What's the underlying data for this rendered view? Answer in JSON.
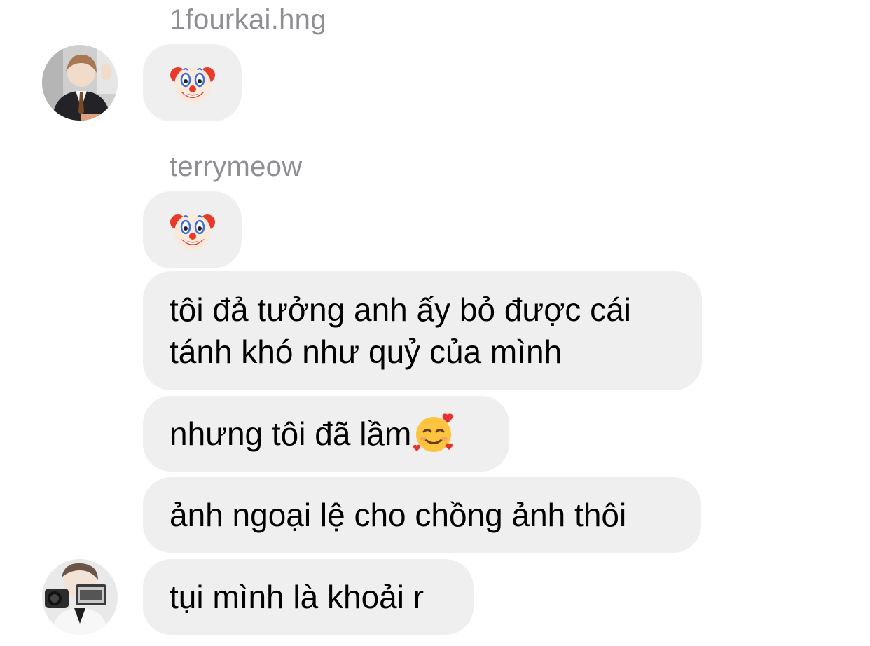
{
  "chat": {
    "groups": [
      {
        "sender": "1fourkai.hng",
        "avatar_icon": "user-avatar-photo",
        "messages": [
          {
            "type": "emoji",
            "icon": "clown-face-emoji"
          }
        ]
      },
      {
        "sender": "terrymeow",
        "avatar_icon": "user-avatar-photo",
        "messages": [
          {
            "type": "emoji",
            "icon": "clown-face-emoji"
          },
          {
            "type": "text",
            "text": "tôi đả tưởng anh ấy bỏ được cái\ntánh khó như quỷ của mình"
          },
          {
            "type": "text",
            "text": "nhưng tôi đã lầm",
            "trailing_icon": "smiling-face-with-hearts-emoji"
          },
          {
            "type": "text",
            "text": "ảnh ngoại lệ cho chồng ảnh thôi"
          },
          {
            "type": "text",
            "text": "tụi mình là khoải r"
          }
        ]
      }
    ]
  },
  "colors": {
    "bubble_background": "#efefef",
    "sender_name": "#8e8e93",
    "message_text": "#000000",
    "background": "#ffffff"
  }
}
